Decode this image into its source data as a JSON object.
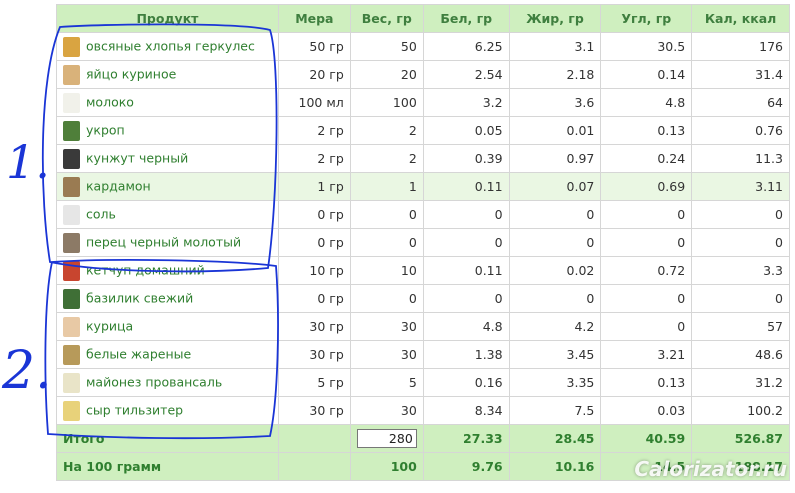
{
  "headers": {
    "product": "Продукт",
    "measure": "Мера",
    "weight": "Вес, гр",
    "protein": "Бел, гр",
    "fat": "Жир, гр",
    "carbs": "Угл, гр",
    "kcal": "Кал, ккал"
  },
  "rows": [
    {
      "name": "овсяные хлопья геркулес",
      "measure": "50 гр",
      "weight": "50",
      "protein": "6.25",
      "fat": "3.1",
      "carbs": "30.5",
      "kcal": "176",
      "icon": "oat-flakes-icon",
      "color": "#d9a441"
    },
    {
      "name": "яйцо куриное",
      "measure": "20 гр",
      "weight": "20",
      "protein": "2.54",
      "fat": "2.18",
      "carbs": "0.14",
      "kcal": "31.4",
      "icon": "egg-icon",
      "color": "#d9b27a"
    },
    {
      "name": "молоко",
      "measure": "100 мл",
      "weight": "100",
      "protein": "3.2",
      "fat": "3.6",
      "carbs": "4.8",
      "kcal": "64",
      "icon": "milk-icon",
      "color": "#f1f1ea"
    },
    {
      "name": "укроп",
      "measure": "2 гр",
      "weight": "2",
      "protein": "0.05",
      "fat": "0.01",
      "carbs": "0.13",
      "kcal": "0.76",
      "icon": "dill-icon",
      "color": "#4f7f3a"
    },
    {
      "name": "кунжут черный",
      "measure": "2 гр",
      "weight": "2",
      "protein": "0.39",
      "fat": "0.97",
      "carbs": "0.24",
      "kcal": "11.3",
      "icon": "black-sesame-icon",
      "color": "#3a3a3a"
    },
    {
      "name": "кардамон",
      "measure": "1 гр",
      "weight": "1",
      "protein": "0.11",
      "fat": "0.07",
      "carbs": "0.69",
      "kcal": "3.11",
      "icon": "cardamom-icon",
      "color": "#9a7b52"
    },
    {
      "name": "соль",
      "measure": "0 гр",
      "weight": "0",
      "protein": "0",
      "fat": "0",
      "carbs": "0",
      "kcal": "0",
      "icon": "salt-icon",
      "color": "#e6e6e6"
    },
    {
      "name": "перец черный молотый",
      "measure": "0 гр",
      "weight": "0",
      "protein": "0",
      "fat": "0",
      "carbs": "0",
      "kcal": "0",
      "icon": "black-pepper-icon",
      "color": "#8c7a66"
    },
    {
      "name": "кетчуп домашний",
      "measure": "10 гр",
      "weight": "10",
      "protein": "0.11",
      "fat": "0.02",
      "carbs": "0.72",
      "kcal": "3.3",
      "icon": "ketchup-icon",
      "color": "#c8452f"
    },
    {
      "name": "базилик свежий",
      "measure": "0 гр",
      "weight": "0",
      "protein": "0",
      "fat": "0",
      "carbs": "0",
      "kcal": "0",
      "icon": "basil-icon",
      "color": "#3f6f36"
    },
    {
      "name": "курица",
      "measure": "30 гр",
      "weight": "30",
      "protein": "4.8",
      "fat": "4.2",
      "carbs": "0",
      "kcal": "57",
      "icon": "chicken-icon",
      "color": "#e8c9a5"
    },
    {
      "name": "белые жареные",
      "measure": "30 гр",
      "weight": "30",
      "protein": "1.38",
      "fat": "3.45",
      "carbs": "3.21",
      "kcal": "48.6",
      "icon": "fried-mushrooms-icon",
      "color": "#b79a5a"
    },
    {
      "name": "майонез провансаль",
      "measure": "5 гр",
      "weight": "5",
      "protein": "0.16",
      "fat": "3.35",
      "carbs": "0.13",
      "kcal": "31.2",
      "icon": "mayonnaise-icon",
      "color": "#e9e4c8"
    },
    {
      "name": "сыр тильзитер",
      "measure": "30 гр",
      "weight": "30",
      "protein": "8.34",
      "fat": "7.5",
      "carbs": "0.03",
      "kcal": "100.2",
      "icon": "cheese-icon",
      "color": "#e8d27a"
    }
  ],
  "total": {
    "label": "Итого",
    "weight_input": "280",
    "protein": "27.33",
    "fat": "28.45",
    "carbs": "40.59",
    "kcal": "526.87"
  },
  "per100": {
    "label": "На 100 грамм",
    "weight": "100",
    "protein": "9.76",
    "fat": "10.16",
    "carbs": "14.5",
    "kcal": "188.17"
  },
  "annotations": {
    "label1": "1.",
    "label2": "2."
  },
  "watermark": "Calorizator.ru",
  "colors": {
    "header_bg": "#cfefbf",
    "text_green": "#2f7f2f",
    "highlight_bg": "#eaf7e3",
    "ink": "#1a35d6"
  }
}
